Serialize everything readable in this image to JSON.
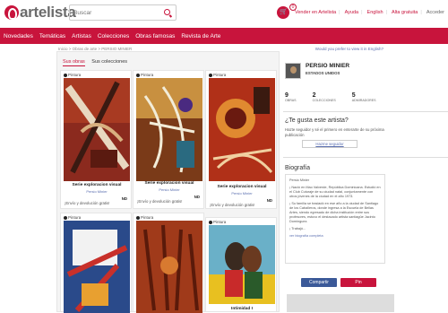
{
  "header": {
    "brand": "artelista",
    "search_placeholder": "Buscar",
    "cart_count": "0",
    "links": [
      "Vender en Artelista",
      "Ayuda",
      "English",
      "Alta gratuita",
      "Acceder"
    ]
  },
  "nav": [
    "Novedades",
    "Temáticas",
    "Artistas",
    "Colecciones",
    "Obras famosas",
    "Revista de Arte"
  ],
  "breadcrumb": "Inicio > Obras de arte > PERSIO MINIER",
  "english_prompt": "Would you prefer to view it in English?",
  "tabs": {
    "works": "Sus obras",
    "collections": "Sus colecciones"
  },
  "cards": [
    {
      "tag": "Pintura",
      "title": "Serie exploracion visual",
      "artist": "Persio Minier",
      "shipping": "¡Envío y devolución gratis!",
      "badge": "ND"
    },
    {
      "tag": "Pintura",
      "title": "Serie exploracion visual",
      "artist": "Persio Minier",
      "shipping": "¡Envío y devolución gratis!",
      "badge": "ND"
    },
    {
      "tag": "Pintura",
      "title": "Serie exploracion visual",
      "artist": "Persio Minier",
      "shipping": "¡Envío y devolución gratis!",
      "badge": "ND"
    },
    {
      "tag": "Pintura",
      "title": "",
      "artist": "",
      "shipping": "",
      "badge": ""
    },
    {
      "tag": "Pintura",
      "title": "",
      "artist": "",
      "shipping": "",
      "badge": ""
    },
    {
      "tag": "Pintura",
      "title": "Intimidad I",
      "artist": "",
      "shipping": "",
      "badge": ""
    }
  ],
  "artist": {
    "name": "PERSIO MINIER",
    "country": "ESTADOS UNIDOS",
    "stats": [
      {
        "n": "9",
        "l": "OBRAS"
      },
      {
        "n": "2",
        "l": "COLECCIONES"
      },
      {
        "n": "5",
        "l": "ADMIRADORES"
      }
    ],
    "question": "¿Te gusta este artista?",
    "question_desc": "Hazte seguidor y sé el primero en enterarte de su próxima publicación",
    "follow": "Hazme seguidor"
  },
  "bio": {
    "heading": "Biografía",
    "name": "Persio Minier",
    "p1": "¡ Nació en Mao Valverde, República Dominicana. Estudió en el Club Cuturaje de su ciudad natal, conjuntamente con otros jóvenes de la ciudad en el año 1973.",
    "p2": "¡ Su familia se trasladó en ese año a la ciudad de Santiago de los Caballeros, donde ingresa a la Escuela de Bellas Artes, siendo egresado de dicha institución entre sus profesores, estuvo el destacado artista santiagüe Jacinto Domínguez.",
    "p3": "¡ Trabajó...",
    "more": "ver biografía completa"
  },
  "share": {
    "fb": "Compartir",
    "pin": "Pin"
  }
}
